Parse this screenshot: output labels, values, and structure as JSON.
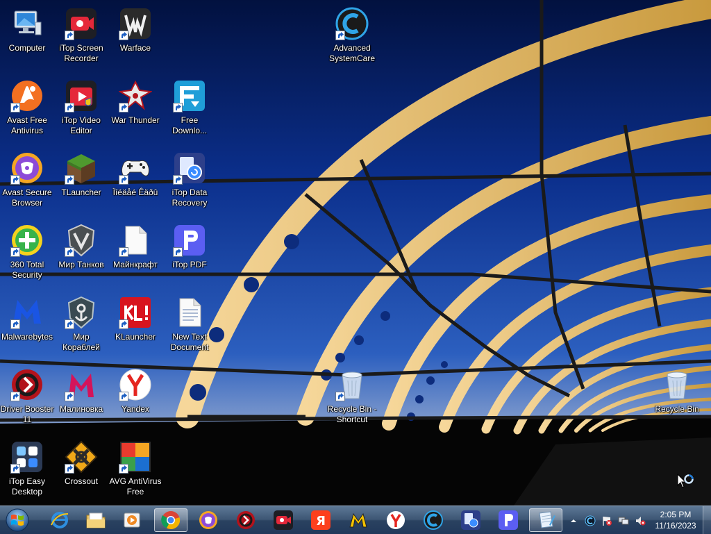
{
  "desktop": {
    "icons": [
      {
        "label": "Computer",
        "icon": "computer-icon",
        "shortcut": false
      },
      {
        "label": "iTop Screen\nRecorder",
        "icon": "itop-screen-recorder-icon",
        "shortcut": true
      },
      {
        "label": "Warface",
        "icon": "warface-icon",
        "shortcut": true
      },
      {
        "label": "Advanced\nSystemCare",
        "icon": "advanced-systemcare-icon",
        "shortcut": true
      },
      {
        "label": "Avast Free\nAntivirus",
        "icon": "avast-antivirus-icon",
        "shortcut": true
      },
      {
        "label": "iTop Video\nEditor",
        "icon": "itop-video-editor-icon",
        "shortcut": true
      },
      {
        "label": "War Thunder",
        "icon": "war-thunder-icon",
        "shortcut": true
      },
      {
        "label": "Free\nDownlo...",
        "icon": "free-download-manager-icon",
        "shortcut": true
      },
      {
        "label": "Avast Secure\nBrowser",
        "icon": "avast-secure-browser-icon",
        "shortcut": true
      },
      {
        "label": "TLauncher",
        "icon": "tlauncher-icon",
        "shortcut": true
      },
      {
        "label": "Ïîëäåé Êäðû",
        "icon": "gamepad-icon",
        "shortcut": true
      },
      {
        "label": "iTop Data\nRecovery",
        "icon": "itop-data-recovery-icon",
        "shortcut": true
      },
      {
        "label": "360 Total\nSecurity",
        "icon": "360-total-security-icon",
        "shortcut": true
      },
      {
        "label": "Мир Танков",
        "icon": "mir-tankov-icon",
        "shortcut": true
      },
      {
        "label": "Майнкрафт",
        "icon": "blank-file-icon",
        "shortcut": true
      },
      {
        "label": "iTop PDF",
        "icon": "itop-pdf-icon",
        "shortcut": true
      },
      {
        "label": "Malwarebytes",
        "icon": "malwarebytes-icon",
        "shortcut": true
      },
      {
        "label": "Мир\nКораблей",
        "icon": "mir-korabley-icon",
        "shortcut": true
      },
      {
        "label": "KLauncher",
        "icon": "klauncher-icon",
        "shortcut": true
      },
      {
        "label": "New Text\nDocument",
        "icon": "text-document-icon",
        "shortcut": false
      },
      {
        "label": "Driver Booster\n11",
        "icon": "driver-booster-icon",
        "shortcut": true
      },
      {
        "label": "Малиновка",
        "icon": "malinovka-icon",
        "shortcut": true
      },
      {
        "label": "Yandex",
        "icon": "yandex-browser-icon",
        "shortcut": true
      },
      {
        "label": "Recycle Bin -\nShortcut",
        "icon": "recycle-bin-icon",
        "shortcut": true
      },
      {
        "label": "Recycle Bin",
        "icon": "recycle-bin-icon",
        "shortcut": false
      },
      {
        "label": "iTop Easy\nDesktop",
        "icon": "itop-easy-desktop-icon",
        "shortcut": true
      },
      {
        "label": "Crossout",
        "icon": "crossout-icon",
        "shortcut": true
      },
      {
        "label": "AVG AntiVirus\nFree",
        "icon": "avg-antivirus-icon",
        "shortcut": true
      }
    ]
  },
  "taskbar": {
    "start_icon": "windows-start-icon",
    "pinned": [
      {
        "icon": "internet-explorer-icon",
        "active": false
      },
      {
        "icon": "file-explorer-icon",
        "active": false
      },
      {
        "icon": "media-player-icon",
        "active": false
      },
      {
        "icon": "chrome-icon",
        "active": true
      },
      {
        "icon": "avast-secure-browser-icon",
        "active": false
      },
      {
        "icon": "driver-booster-icon",
        "active": false
      },
      {
        "icon": "itop-screen-recorder-icon",
        "active": false
      },
      {
        "icon": "yandex-icon",
        "active": false
      },
      {
        "icon": "malinovka-icon",
        "active": false
      },
      {
        "icon": "yandex-browser-icon",
        "active": false
      },
      {
        "icon": "advanced-systemcare-icon",
        "active": false
      },
      {
        "icon": "itop-data-recovery-icon",
        "active": false
      },
      {
        "icon": "itop-pdf-icon",
        "active": false
      },
      {
        "icon": "notepad-icon",
        "active": true
      }
    ],
    "tray": {
      "icons": [
        "show-hidden-icons-chevron",
        "advanced-systemcare-tray-icon",
        "action-center-flag-icon",
        "network-icon",
        "volume-muted-icon"
      ]
    },
    "clock": {
      "time": "2:05 PM",
      "date": "11/16/2023"
    }
  },
  "colors": {
    "sky_top": "#061a5c",
    "sky_mid": "#0b3aa8",
    "horizon": "#7b91b8",
    "bridge": "#e8c97a"
  }
}
